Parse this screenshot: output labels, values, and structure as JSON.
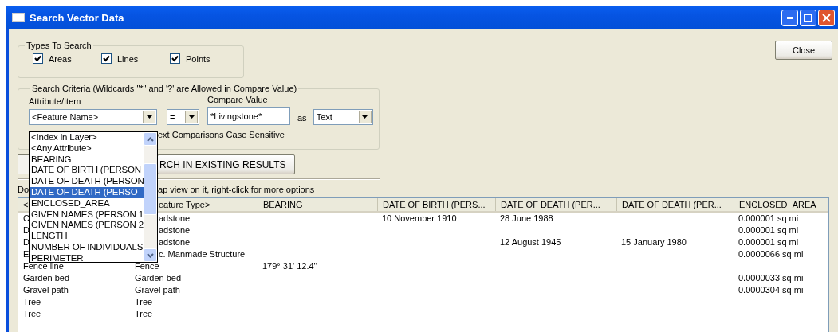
{
  "window": {
    "title": "Search Vector Data"
  },
  "close_button": "Close",
  "types_group": {
    "title": "Types To Search",
    "options": [
      {
        "label": "Areas",
        "checked": true
      },
      {
        "label": "Lines",
        "checked": true
      },
      {
        "label": "Points",
        "checked": true
      }
    ]
  },
  "criteria_group": {
    "title": "Search Criteria (Wildcards \"*\" and '?' are Allowed in Compare Value)",
    "attribute_label": "Attribute/Item",
    "attribute_value": "<Feature Name>",
    "operator": "=",
    "compare_label": "Compare Value",
    "compare_value": "*Livingstone*",
    "as_label": "as",
    "type_value": "Text",
    "case_label": "ext Comparisons Case Sensitive"
  },
  "search_button": "RCH IN EXISTING RESULTS",
  "hint": {
    "left": "Do",
    "right": "ap view on it, right-click for more options"
  },
  "attribute_list": {
    "items": [
      {
        "label": "<Index in Layer>",
        "selected": false
      },
      {
        "label": "<Any Attribute>",
        "selected": false
      },
      {
        "label": "BEARING",
        "selected": false
      },
      {
        "label": "DATE OF BIRTH (PERSON",
        "selected": false
      },
      {
        "label": "DATE OF DEATH (PERSON",
        "selected": false
      },
      {
        "label": "DATE OF DEATH (PERSO",
        "selected": true
      },
      {
        "label": "ENCLOSED_AREA",
        "selected": false
      },
      {
        "label": "GIVEN NAMES (PERSON 1",
        "selected": false
      },
      {
        "label": "GIVEN NAMES (PERSON 2",
        "selected": false
      },
      {
        "label": "LENGTH",
        "selected": false
      },
      {
        "label": "NUMBER OF INDIVIDUALS",
        "selected": false
      },
      {
        "label": "PERIMETER",
        "selected": false
      }
    ]
  },
  "table": {
    "columns": [
      "<",
      "eature Type>",
      "BEARING",
      "DATE OF BIRTH (PERS...",
      "DATE OF DEATH (PER...",
      "DATE OF DEATH (PER...",
      "ENCLOSED_AREA"
    ],
    "rows": [
      [
        "C",
        "adstone",
        null,
        "10 November 1910",
        "28 June 1988",
        null,
        "0.000001 sq mi"
      ],
      [
        "D",
        "adstone",
        null,
        null,
        null,
        null,
        "0.000001 sq mi"
      ],
      [
        "D",
        "adstone",
        null,
        null,
        "12 August 1945",
        "15 January 1980",
        "0.000001 sq mi"
      ],
      [
        "E",
        "c. Manmade Structure",
        null,
        null,
        null,
        null,
        "0.0000066 sq mi"
      ],
      [
        "Fence line",
        "Fence",
        "179° 31' 12.4''",
        null,
        null,
        null,
        null
      ],
      [
        "Garden bed",
        "Garden bed",
        null,
        null,
        null,
        null,
        "0.0000033 sq mi"
      ],
      [
        "Gravel path",
        "Gravel path",
        null,
        null,
        null,
        null,
        "0.0000304 sq mi"
      ],
      [
        "Tree",
        "Tree",
        null,
        null,
        null,
        null,
        null
      ],
      [
        "Tree",
        "Tree",
        null,
        null,
        null,
        null,
        null
      ]
    ]
  }
}
